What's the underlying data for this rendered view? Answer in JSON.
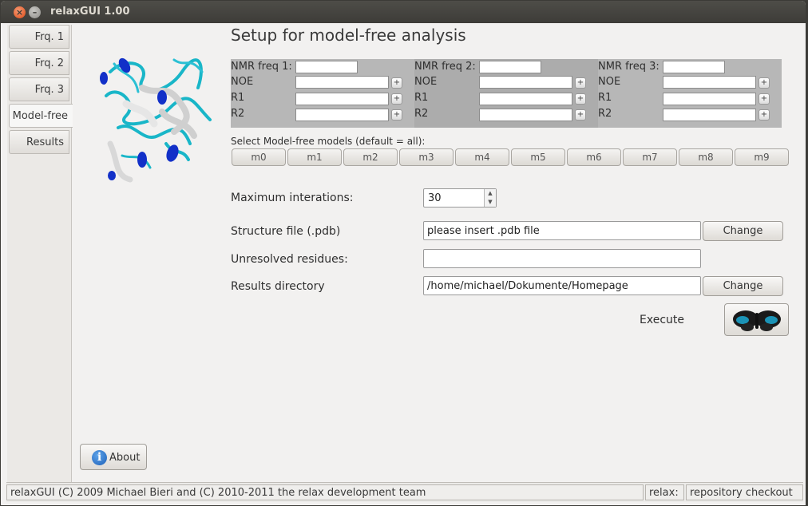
{
  "window": {
    "title": "relaxGUI 1.00"
  },
  "sidebar": {
    "tabs": [
      {
        "label": "Frq. 1"
      },
      {
        "label": "Frq. 2"
      },
      {
        "label": "Frq. 3"
      },
      {
        "label": "Model-free",
        "active": true
      },
      {
        "label": "Results"
      }
    ]
  },
  "main": {
    "heading": "Setup for model-free analysis",
    "freq_blocks": [
      {
        "freq_label": "NMR freq 1:",
        "noe_label": "NOE",
        "r1_label": "R1",
        "r2_label": "R2",
        "freq_value": "",
        "noe_value": "",
        "r1_value": "",
        "r2_value": "",
        "plus": "+"
      },
      {
        "freq_label": "NMR freq 2:",
        "noe_label": "NOE",
        "r1_label": "R1",
        "r2_label": "R2",
        "freq_value": "",
        "noe_value": "",
        "r1_value": "",
        "r2_value": "",
        "plus": "+"
      },
      {
        "freq_label": "NMR freq 3:",
        "noe_label": "NOE",
        "r1_label": "R1",
        "r2_label": "R2",
        "freq_value": "",
        "noe_value": "",
        "r1_value": "",
        "r2_value": "",
        "plus": "+"
      }
    ],
    "models_label": "Select Model-free models (default = all):",
    "models": [
      "m0",
      "m1",
      "m2",
      "m3",
      "m4",
      "m5",
      "m6",
      "m7",
      "m8",
      "m9"
    ],
    "max_iter_label": "Maximum interations:",
    "max_iter_value": "30",
    "structure_label": "Structure file (.pdb)",
    "structure_value": "please insert .pdb file",
    "change_label": "Change",
    "unresolved_label": "Unresolved residues:",
    "unresolved_value": "",
    "results_dir_label": "Results directory",
    "results_dir_value": "/home/michael/Dokumente/Homepage",
    "execute_label": "Execute",
    "about_label": "About"
  },
  "status": {
    "copyright": "relaxGUI (C) 2009 Michael Bieri and (C) 2010-2011 the relax development team",
    "relax_label": "relax:",
    "version": "repository checkout"
  },
  "colors": {
    "window_bg": "#f2f1f0",
    "titlebar": "#3c3b37",
    "close": "#df4b16",
    "protein_cyan": "#19b6c8",
    "protein_blue": "#1230c8"
  },
  "icons": {
    "info": "info-icon",
    "execute": "butterfly-icon",
    "structure": "protein-structure-image"
  }
}
